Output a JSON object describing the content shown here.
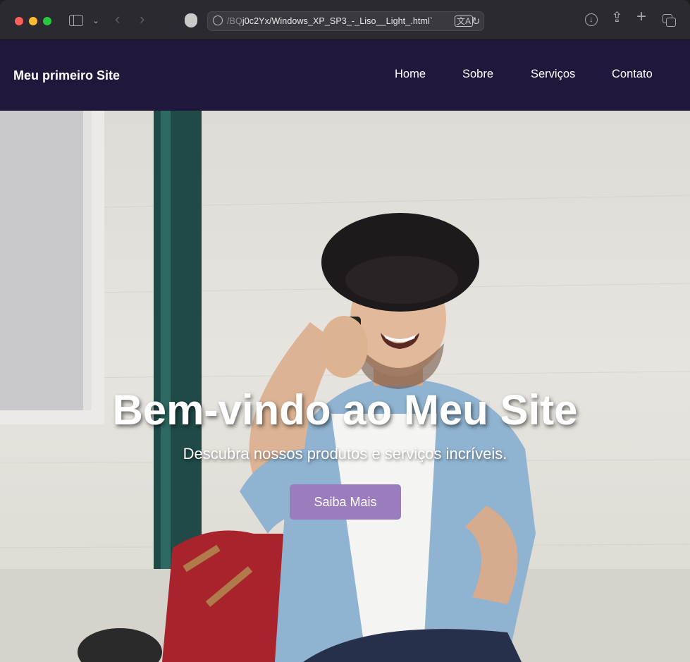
{
  "browser": {
    "url_prefix": "/BQ",
    "url_main": "j0c2Yx/Windows_XP_SP3_-_Liso__Light_.html`",
    "translate_glyph": "文A",
    "reload_glyph": "↻",
    "back_glyph": "‹",
    "forward_glyph": "›",
    "chevron_glyph": "⌄",
    "share_glyph": "⇪",
    "plus_glyph": "+",
    "download_glyph": "↓"
  },
  "header": {
    "logo": "Meu primeiro Site",
    "nav": [
      "Home",
      "Sobre",
      "Serviços",
      "Contato"
    ],
    "background": "#20183a"
  },
  "hero": {
    "title": "Bem-vindo ao Meu Site",
    "subtitle": "Descubra nossos produtos e serviços incríveis.",
    "button": "Saiba Mais",
    "button_color": "#9b7dbd",
    "image_description": "smiling man in a hat talking on a phone"
  }
}
